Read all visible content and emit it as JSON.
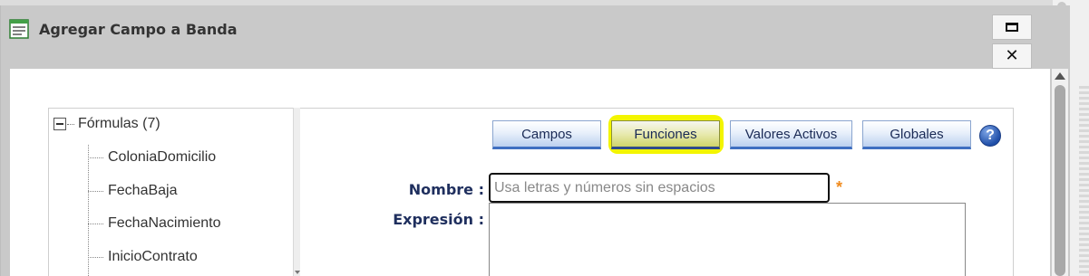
{
  "dialog": {
    "title": "Agregar Campo a Banda",
    "maximize_icon": "maximize-icon",
    "close_icon": "close-icon",
    "close_glyph": "✕"
  },
  "tree": {
    "root_label": "Fórmulas (7)",
    "items": [
      {
        "label": "ColoniaDomicilio"
      },
      {
        "label": "FechaBaja"
      },
      {
        "label": "FechaNacimiento"
      },
      {
        "label": "InicioContrato"
      }
    ]
  },
  "tabs": [
    {
      "label": "Campos",
      "active": false
    },
    {
      "label": "Funciones",
      "active": true
    },
    {
      "label": "Valores Activos",
      "active": false
    },
    {
      "label": "Globales",
      "active": false
    }
  ],
  "help": {
    "glyph": "?"
  },
  "form": {
    "nombre_label": "Nombre :",
    "nombre_placeholder": "Usa letras y números sin espacios",
    "nombre_value": "",
    "required_marker": "*",
    "expresion_label": "Expresión :",
    "expresion_value": ""
  },
  "colors": {
    "tab_highlight": "#f3f500",
    "label_text": "#1f2f5e",
    "required_star": "#f08a1c"
  }
}
